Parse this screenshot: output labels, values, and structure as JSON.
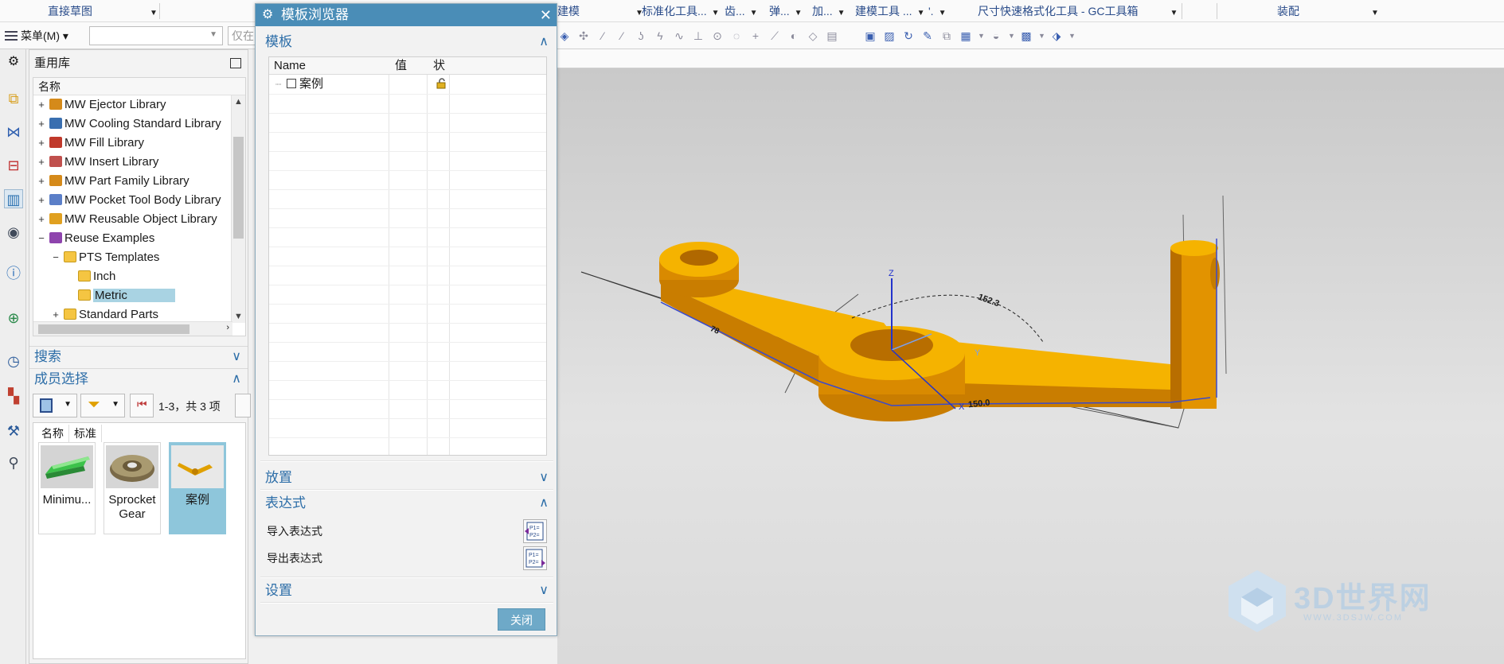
{
  "ribbon": {
    "items": [
      {
        "label": "直接草图"
      },
      {
        "label": "建模"
      },
      {
        "label": "标准化工具..."
      },
      {
        "label": "齿..."
      },
      {
        "label": "弹..."
      },
      {
        "label": "加..."
      },
      {
        "label": "建模工具 ..."
      },
      {
        "label": "'."
      },
      {
        "label": "尺寸快速格式化工具 - GC工具箱"
      },
      {
        "label": "装配"
      }
    ],
    "menu_label": "菜单(M)",
    "filter_placeholder": "仅在"
  },
  "library": {
    "title": "重用库",
    "column": "名称",
    "tree": [
      {
        "label": "MW Ejector Library",
        "pm": "+",
        "color": "#d58a1a"
      },
      {
        "label": "MW Cooling Standard Library",
        "pm": "+",
        "color": "#3a6fb0"
      },
      {
        "label": "MW Fill Library",
        "pm": "+",
        "color": "#c0392b"
      },
      {
        "label": "MW Insert Library",
        "pm": "+",
        "color": "#c0504d"
      },
      {
        "label": "MW Part Family Library",
        "pm": "+",
        "color": "#d58a1a"
      },
      {
        "label": "MW Pocket Tool Body Library",
        "pm": "+",
        "color": "#5b7fc8"
      },
      {
        "label": "MW Reusable Object Library",
        "pm": "+",
        "color": "#e0a020"
      },
      {
        "label": "Reuse Examples",
        "pm": "−",
        "color": "#8e44ad"
      },
      {
        "label": "PTS Templates",
        "pm": "−",
        "color": "folder"
      },
      {
        "label": "Inch",
        "pm": "",
        "color": "folder"
      },
      {
        "label": "Metric",
        "pm": "",
        "color": "folder"
      },
      {
        "label": "Standard Parts",
        "pm": "+",
        "color": "folder"
      }
    ],
    "search_label": "搜索",
    "member_label": "成员选择",
    "member_count": "1-3，共 3 项",
    "member_cols": [
      "名称",
      "标准"
    ],
    "members": [
      {
        "label": "Minimu..."
      },
      {
        "label": "Sprocket Gear"
      },
      {
        "label": "案例"
      }
    ]
  },
  "dialog": {
    "title": "模板浏览器",
    "template_section": "模板",
    "table_headers": [
      "Name",
      "值",
      "状"
    ],
    "rows": [
      {
        "name": "案例"
      }
    ],
    "placement": "放置",
    "expression": "表达式",
    "import_expr": "导入表达式",
    "export_expr": "导出表达式",
    "settings": "设置",
    "close": "关闭"
  },
  "viewport": {
    "dim1": "152.3",
    "dim2": "150.0",
    "dim3": "78",
    "axis_z": "Z",
    "axis_x": "X",
    "axis_y": "Y"
  },
  "watermark": {
    "text": "3D世界网",
    "sub": "WWW.3DSJW.COM"
  },
  "colors": {
    "accent": "#4a8db7",
    "part": "#f5b300",
    "selection": "#a9d3e3"
  }
}
